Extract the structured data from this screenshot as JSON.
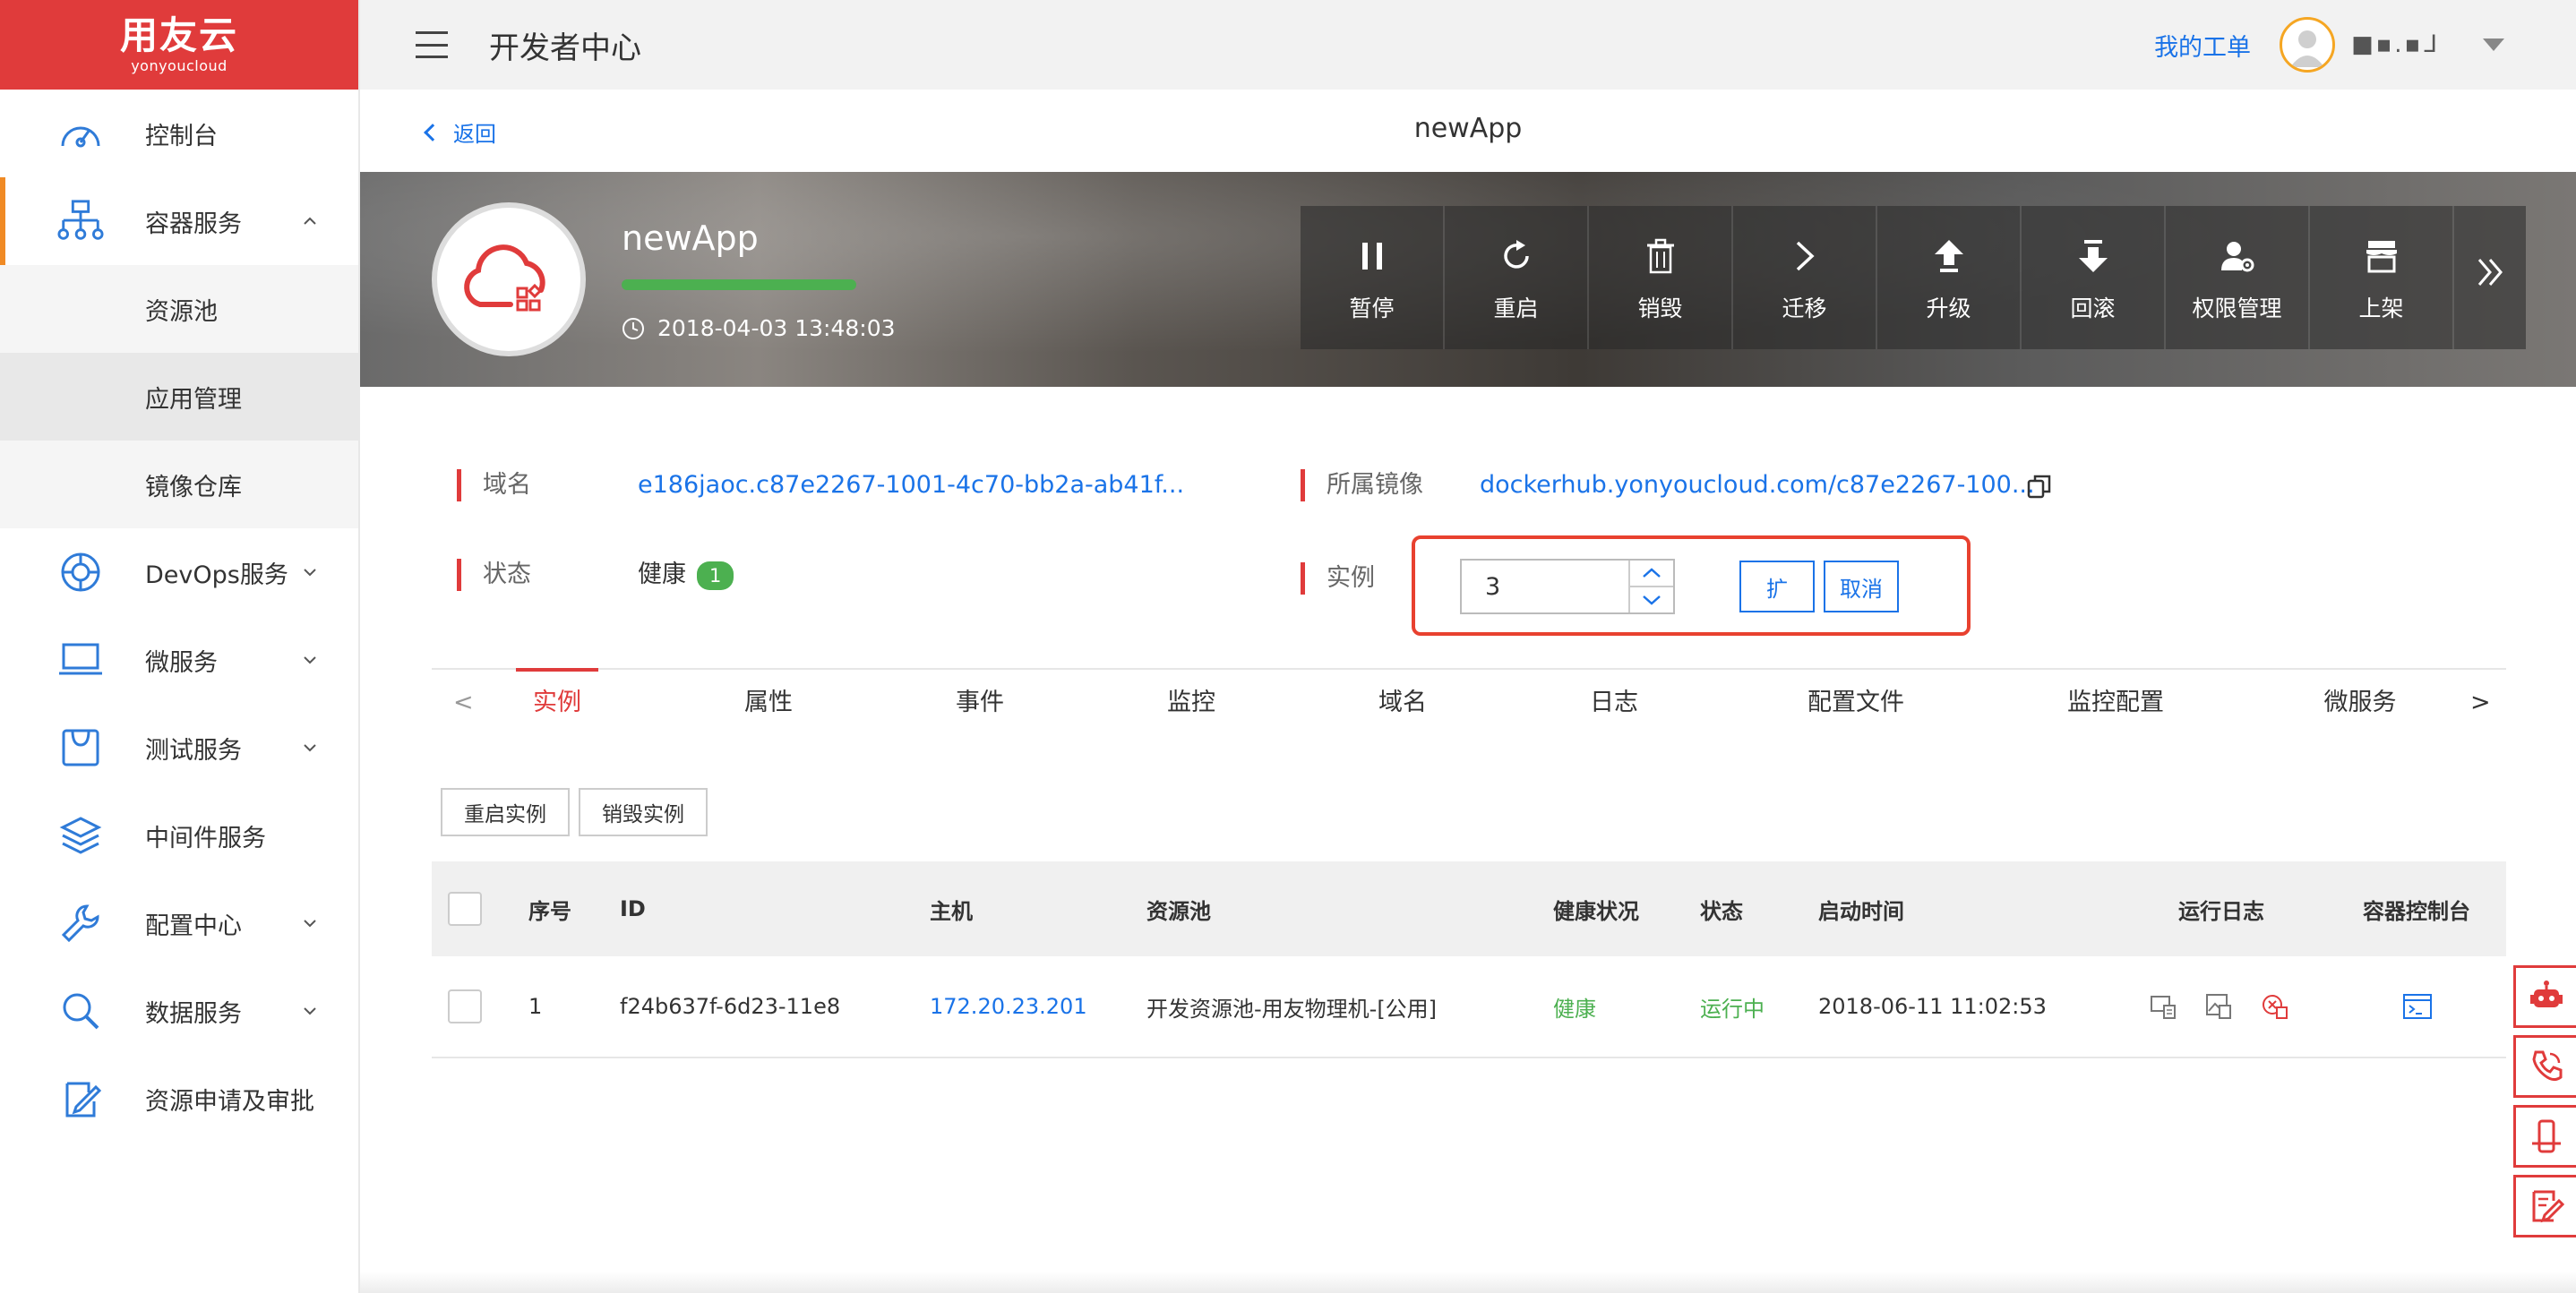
{
  "brand": {
    "cn": "用友云",
    "en": "yonyoucloud"
  },
  "topbar": {
    "title": "开发者中心",
    "ticket": "我的工单",
    "username": "■▪.▪ᒧ"
  },
  "sidebar": {
    "items": [
      {
        "label": "控制台"
      },
      {
        "label": "容器服务"
      },
      {
        "label": "DevOps服务"
      },
      {
        "label": "微服务"
      },
      {
        "label": "测试服务"
      },
      {
        "label": "中间件服务"
      },
      {
        "label": "配置中心"
      },
      {
        "label": "数据服务"
      },
      {
        "label": "资源申请及审批"
      }
    ],
    "sub_items": [
      {
        "label": "资源池"
      },
      {
        "label": "应用管理"
      },
      {
        "label": "镜像仓库"
      }
    ]
  },
  "subheader": {
    "back": "返回",
    "title": "newApp"
  },
  "app": {
    "name": "newApp",
    "created": "2018-04-03 13:48:03",
    "health_level": 1.0
  },
  "actions": [
    {
      "label": "暂停",
      "icon": "pause-icon"
    },
    {
      "label": "重启",
      "icon": "restart-icon"
    },
    {
      "label": "销毁",
      "icon": "trash-icon"
    },
    {
      "label": "迁移",
      "icon": "chevron-right-icon"
    },
    {
      "label": "升级",
      "icon": "upgrade-icon"
    },
    {
      "label": "回滚",
      "icon": "rollback-icon"
    },
    {
      "label": "权限管理",
      "icon": "permission-icon"
    },
    {
      "label": "上架",
      "icon": "store-icon"
    }
  ],
  "info": {
    "domain_label": "域名",
    "domain_value": "e186jaoc.c87e2267-1001-4c70-bb2a-ab41f...",
    "image_label": "所属镜像",
    "image_value": "dockerhub.yonyoucloud.com/c87e2267-100...",
    "status_label": "状态",
    "status_value": "健康",
    "status_count": "1",
    "instance_label": "实例",
    "instance_value": "3",
    "scale_btn": "扩",
    "cancel_btn": "取消"
  },
  "tabs": [
    {
      "label": "实例"
    },
    {
      "label": "属性"
    },
    {
      "label": "事件"
    },
    {
      "label": "监控"
    },
    {
      "label": "域名"
    },
    {
      "label": "日志"
    },
    {
      "label": "配置文件"
    },
    {
      "label": "监控配置"
    },
    {
      "label": "微服务"
    }
  ],
  "tab_prev": "<",
  "tab_next": ">",
  "buttons": {
    "restart_instances": "重启实例",
    "destroy_instances": "销毁实例"
  },
  "table": {
    "headers": [
      "序号",
      "ID",
      "主机",
      "资源池",
      "健康状况",
      "状态",
      "启动时间",
      "运行日志",
      "容器控制台"
    ],
    "rows": [
      {
        "index": "1",
        "id": "f24b637f-6d23-11e8",
        "host": "172.20.23.201",
        "pool": "开发资源池-用友物理机-[公用]",
        "health": "健康",
        "state": "运行中",
        "start": "2018-06-11 11:02:53"
      }
    ]
  },
  "colors": {
    "brand_red": "#e03b3b",
    "link_blue": "#1a73e8",
    "ok_green": "#4cb050",
    "accent_orange": "#f08a24",
    "highlight": "#e8412f"
  }
}
